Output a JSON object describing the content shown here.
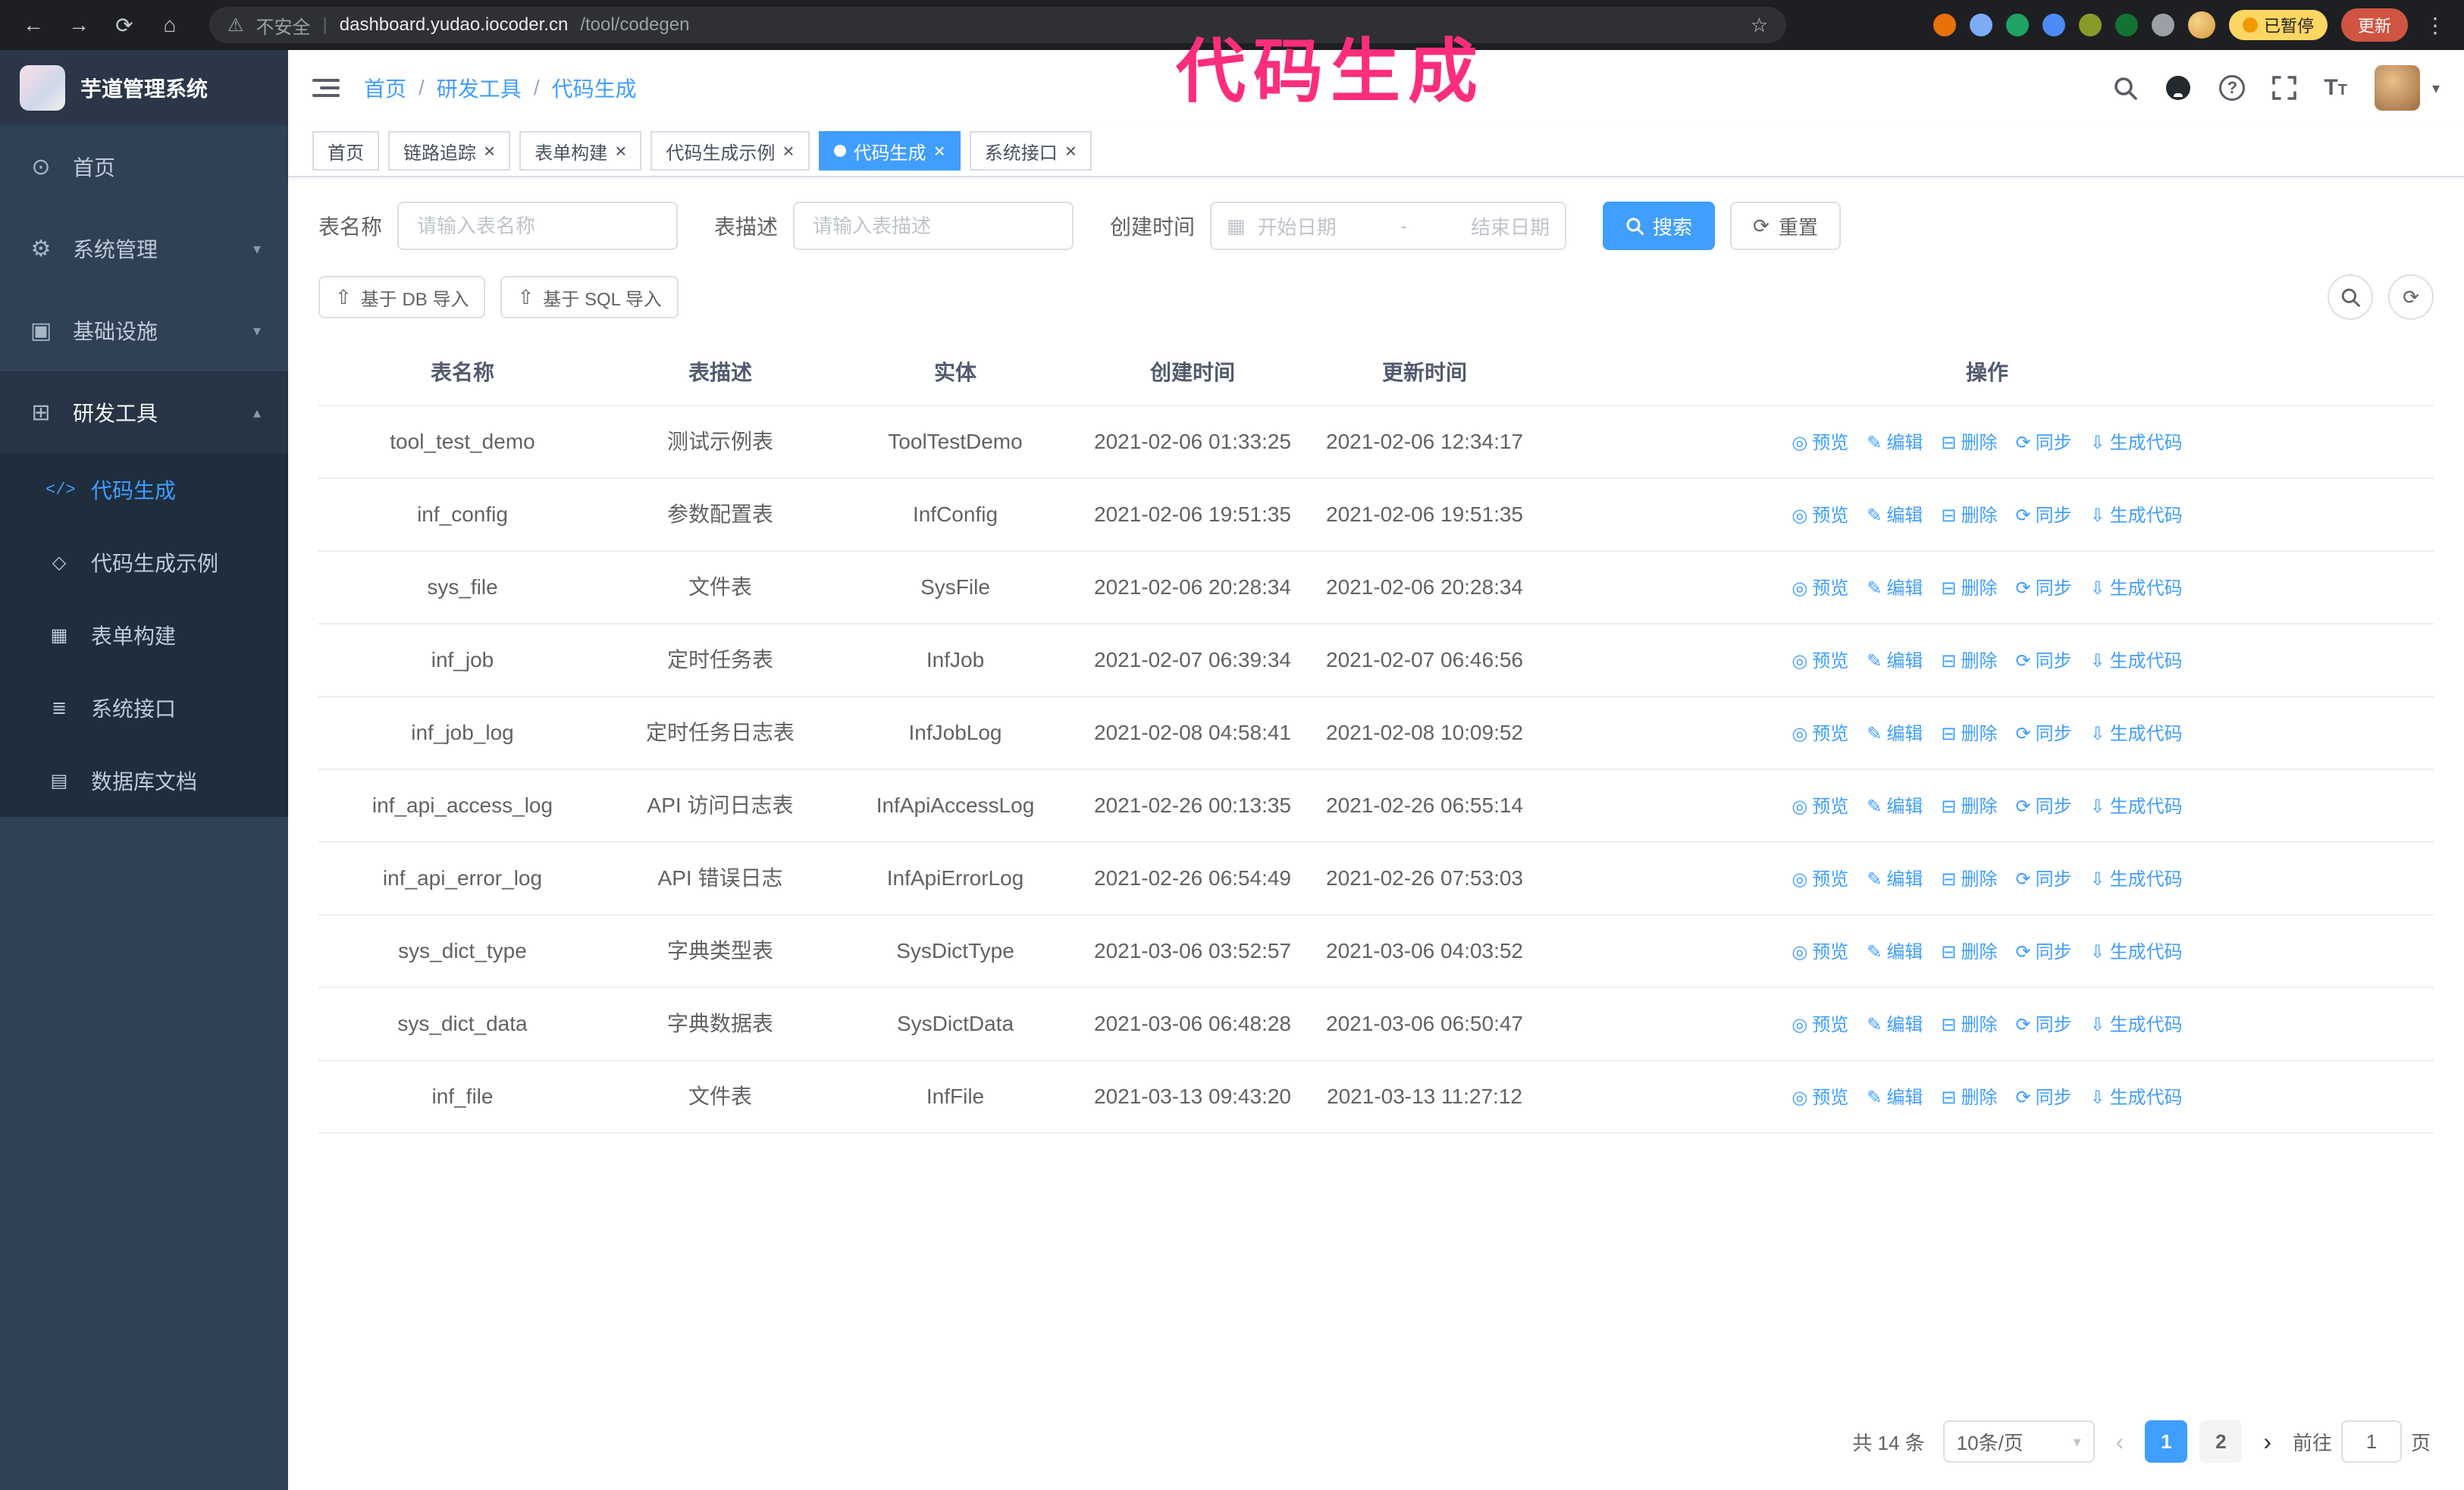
{
  "chrome": {
    "warning_label": "不安全",
    "url_domain": "dashboard.yudao.iocoder.cn",
    "url_path": "/tool/codegen",
    "paused_badge": "已暂停",
    "update_button": "更新",
    "extension_colors": [
      "#e8710a",
      "#7cacf8",
      "#1ea362",
      "#4c8bf5",
      "#8a9a2a",
      "#137333",
      "#9aa0a6"
    ]
  },
  "annotation": "代码生成",
  "sidebar": {
    "app_title": "芋道管理系统",
    "items": [
      {
        "label": "首页"
      },
      {
        "label": "系统管理"
      },
      {
        "label": "基础设施"
      },
      {
        "label": "研发工具"
      }
    ],
    "subitems": [
      {
        "label": "代码生成",
        "active": true
      },
      {
        "label": "代码生成示例"
      },
      {
        "label": "表单构建"
      },
      {
        "label": "系统接口"
      },
      {
        "label": "数据库文档"
      }
    ]
  },
  "breadcrumb": {
    "items": [
      "首页",
      "研发工具",
      "代码生成"
    ]
  },
  "tabs": [
    {
      "label": "首页",
      "closable": false,
      "active": false
    },
    {
      "label": "链路追踪",
      "closable": true,
      "active": false
    },
    {
      "label": "表单构建",
      "closable": true,
      "active": false
    },
    {
      "label": "代码生成示例",
      "closable": true,
      "active": false
    },
    {
      "label": "代码生成",
      "closable": true,
      "active": true
    },
    {
      "label": "系统接口",
      "closable": true,
      "active": false
    }
  ],
  "filters": {
    "table_name_label": "表名称",
    "table_name_placeholder": "请输入表名称",
    "table_desc_label": "表描述",
    "table_desc_placeholder": "请输入表描述",
    "create_time_label": "创建时间",
    "date_start_placeholder": "开始日期",
    "date_separator": "-",
    "date_end_placeholder": "结束日期",
    "search_button": "搜索",
    "reset_button": "重置"
  },
  "toolbar": {
    "import_db": "基于 DB 导入",
    "import_sql": "基于 SQL 导入"
  },
  "table": {
    "columns": [
      "表名称",
      "表描述",
      "实体",
      "创建时间",
      "更新时间",
      "操作"
    ],
    "actions": [
      "预览",
      "编辑",
      "删除",
      "同步",
      "生成代码"
    ],
    "action_icons": [
      "eye-icon",
      "edit-pencil-icon",
      "delete-trash-icon",
      "sync-refresh-icon",
      "generate-download-icon"
    ],
    "rows": [
      {
        "name": "tool_test_demo",
        "desc": "测试示例表",
        "entity": "ToolTestDemo",
        "created": "2021-02-06 01:33:25",
        "updated": "2021-02-06 12:34:17"
      },
      {
        "name": "inf_config",
        "desc": "参数配置表",
        "entity": "InfConfig",
        "created": "2021-02-06 19:51:35",
        "updated": "2021-02-06 19:51:35"
      },
      {
        "name": "sys_file",
        "desc": "文件表",
        "entity": "SysFile",
        "created": "2021-02-06 20:28:34",
        "updated": "2021-02-06 20:28:34"
      },
      {
        "name": "inf_job",
        "desc": "定时任务表",
        "entity": "InfJob",
        "created": "2021-02-07 06:39:34",
        "updated": "2021-02-07 06:46:56"
      },
      {
        "name": "inf_job_log",
        "desc": "定时任务日志表",
        "entity": "InfJobLog",
        "created": "2021-02-08 04:58:41",
        "updated": "2021-02-08 10:09:52"
      },
      {
        "name": "inf_api_access_log",
        "desc": "API 访问日志表",
        "entity": "InfApiAccessLog",
        "created": "2021-02-26 00:13:35",
        "updated": "2021-02-26 06:55:14"
      },
      {
        "name": "inf_api_error_log",
        "desc": "API 错误日志",
        "entity": "InfApiErrorLog",
        "created": "2021-02-26 06:54:49",
        "updated": "2021-02-26 07:53:03"
      },
      {
        "name": "sys_dict_type",
        "desc": "字典类型表",
        "entity": "SysDictType",
        "created": "2021-03-06 03:52:57",
        "updated": "2021-03-06 04:03:52"
      },
      {
        "name": "sys_dict_data",
        "desc": "字典数据表",
        "entity": "SysDictData",
        "created": "2021-03-06 06:48:28",
        "updated": "2021-03-06 06:50:47"
      },
      {
        "name": "inf_file",
        "desc": "文件表",
        "entity": "InfFile",
        "created": "2021-03-13 09:43:20",
        "updated": "2021-03-13 11:27:12"
      }
    ]
  },
  "pagination": {
    "total": "共 14 条",
    "page_size": "10条/页",
    "pages": [
      "1",
      "2"
    ],
    "active_page": "1",
    "goto_label": "前往",
    "goto_value": "1",
    "goto_unit": "页"
  },
  "colors": {
    "primary": "#409eff",
    "sidebar_bg": "#304156",
    "submenu_bg": "#1f2d3d",
    "annotation": "#fb2d7c"
  }
}
